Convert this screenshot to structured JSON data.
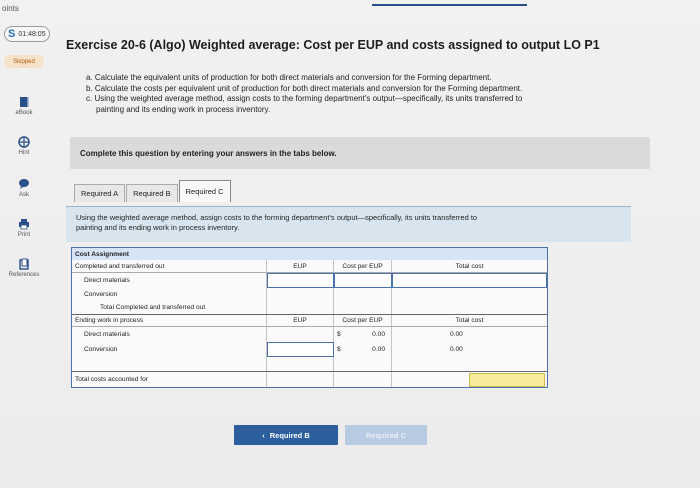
{
  "rail": {
    "points_label": "oints",
    "timer": "01:48:05",
    "skipped": "Skipped",
    "items": [
      {
        "label": "eBook"
      },
      {
        "label": "Hint"
      },
      {
        "label": "Ask"
      },
      {
        "label": "Print"
      },
      {
        "label": "References"
      }
    ]
  },
  "title": "Exercise 20-6 (Algo) Weighted average: Cost per EUP and costs assigned to output LO P1",
  "tasks": [
    "a. Calculate the equivalent units of production for both direct materials and conversion for the Forming department.",
    "b. Calculate the costs per equivalent unit of production for both direct materials and conversion for the Forming department.",
    "c. Using the weighted average method, assign costs to the forming department's output—specifically, its units transferred to",
    "painting and its ending work in process inventory."
  ],
  "instruction": "Complete this question by entering your answers in the tabs below.",
  "tabs": [
    "Required A",
    "Required B",
    "Required C"
  ],
  "prompt_lines": [
    "Using the weighted average method, assign costs to the forming department's output—specifically, its units transferred to",
    "painting and its ending work in process inventory."
  ],
  "table": {
    "header": "Cost Assignment",
    "completed_label": "Completed and transferred out",
    "col_eup": "EUP",
    "col_cost_per_eup": "Cost per EUP",
    "col_total_cost": "Total cost",
    "direct_materials": "Direct materials",
    "conversion": "Conversion",
    "total_completed": "Total Completed and transferred out",
    "ending_label": "Ending work in process",
    "dm_cost_per_eup": "0.00",
    "conv_cost_per_eup": "0.00",
    "dm_total": "0.00",
    "conv_total": "0.00",
    "dollar": "$",
    "total_accounted": "Total costs accounted for"
  },
  "buttons": {
    "prev": "Required B",
    "next": "Required C"
  }
}
